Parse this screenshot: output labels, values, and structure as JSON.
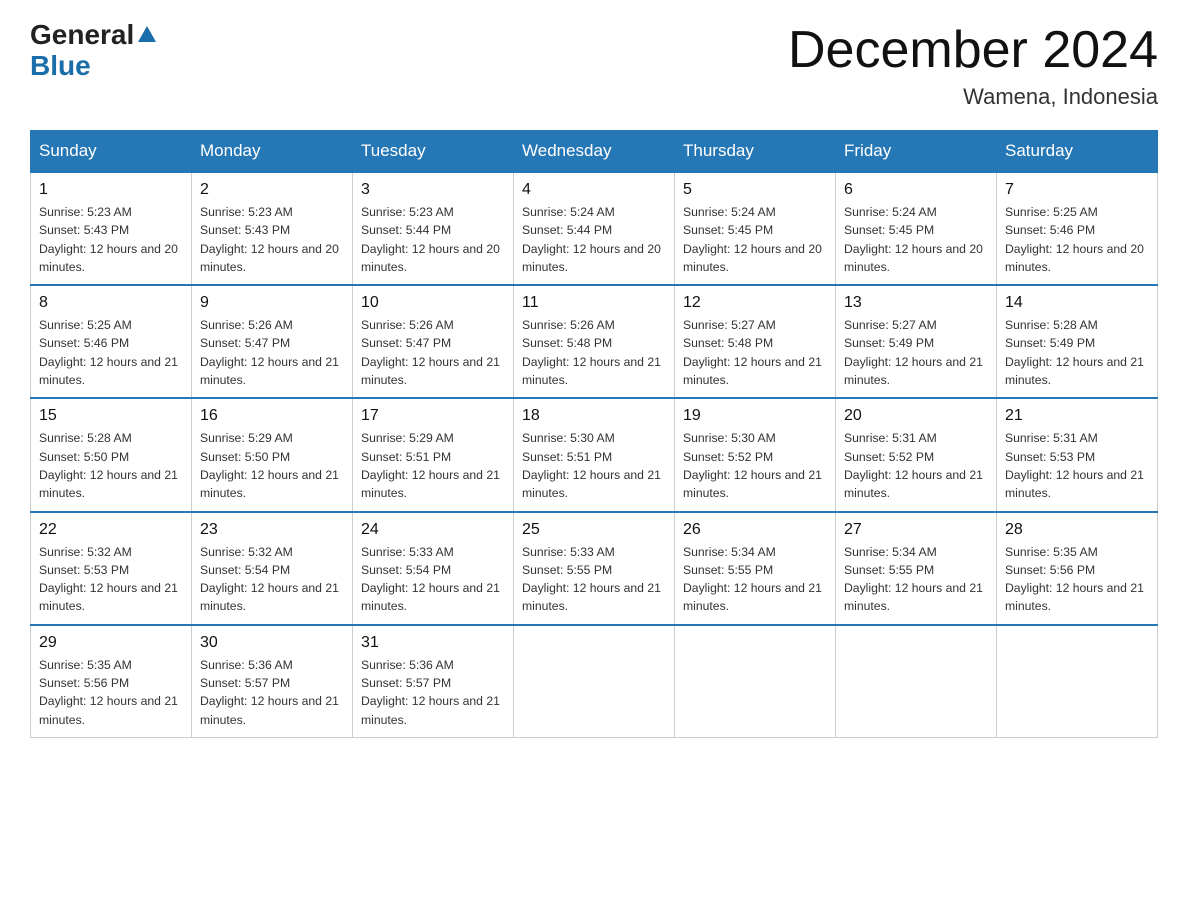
{
  "header": {
    "logo_general": "General",
    "logo_blue": "Blue",
    "title": "December 2024",
    "location": "Wamena, Indonesia"
  },
  "days_of_week": [
    "Sunday",
    "Monday",
    "Tuesday",
    "Wednesday",
    "Thursday",
    "Friday",
    "Saturday"
  ],
  "weeks": [
    [
      {
        "day": "1",
        "sunrise": "5:23 AM",
        "sunset": "5:43 PM",
        "daylight": "12 hours and 20 minutes."
      },
      {
        "day": "2",
        "sunrise": "5:23 AM",
        "sunset": "5:43 PM",
        "daylight": "12 hours and 20 minutes."
      },
      {
        "day": "3",
        "sunrise": "5:23 AM",
        "sunset": "5:44 PM",
        "daylight": "12 hours and 20 minutes."
      },
      {
        "day": "4",
        "sunrise": "5:24 AM",
        "sunset": "5:44 PM",
        "daylight": "12 hours and 20 minutes."
      },
      {
        "day": "5",
        "sunrise": "5:24 AM",
        "sunset": "5:45 PM",
        "daylight": "12 hours and 20 minutes."
      },
      {
        "day": "6",
        "sunrise": "5:24 AM",
        "sunset": "5:45 PM",
        "daylight": "12 hours and 20 minutes."
      },
      {
        "day": "7",
        "sunrise": "5:25 AM",
        "sunset": "5:46 PM",
        "daylight": "12 hours and 20 minutes."
      }
    ],
    [
      {
        "day": "8",
        "sunrise": "5:25 AM",
        "sunset": "5:46 PM",
        "daylight": "12 hours and 21 minutes."
      },
      {
        "day": "9",
        "sunrise": "5:26 AM",
        "sunset": "5:47 PM",
        "daylight": "12 hours and 21 minutes."
      },
      {
        "day": "10",
        "sunrise": "5:26 AM",
        "sunset": "5:47 PM",
        "daylight": "12 hours and 21 minutes."
      },
      {
        "day": "11",
        "sunrise": "5:26 AM",
        "sunset": "5:48 PM",
        "daylight": "12 hours and 21 minutes."
      },
      {
        "day": "12",
        "sunrise": "5:27 AM",
        "sunset": "5:48 PM",
        "daylight": "12 hours and 21 minutes."
      },
      {
        "day": "13",
        "sunrise": "5:27 AM",
        "sunset": "5:49 PM",
        "daylight": "12 hours and 21 minutes."
      },
      {
        "day": "14",
        "sunrise": "5:28 AM",
        "sunset": "5:49 PM",
        "daylight": "12 hours and 21 minutes."
      }
    ],
    [
      {
        "day": "15",
        "sunrise": "5:28 AM",
        "sunset": "5:50 PM",
        "daylight": "12 hours and 21 minutes."
      },
      {
        "day": "16",
        "sunrise": "5:29 AM",
        "sunset": "5:50 PM",
        "daylight": "12 hours and 21 minutes."
      },
      {
        "day": "17",
        "sunrise": "5:29 AM",
        "sunset": "5:51 PM",
        "daylight": "12 hours and 21 minutes."
      },
      {
        "day": "18",
        "sunrise": "5:30 AM",
        "sunset": "5:51 PM",
        "daylight": "12 hours and 21 minutes."
      },
      {
        "day": "19",
        "sunrise": "5:30 AM",
        "sunset": "5:52 PM",
        "daylight": "12 hours and 21 minutes."
      },
      {
        "day": "20",
        "sunrise": "5:31 AM",
        "sunset": "5:52 PM",
        "daylight": "12 hours and 21 minutes."
      },
      {
        "day": "21",
        "sunrise": "5:31 AM",
        "sunset": "5:53 PM",
        "daylight": "12 hours and 21 minutes."
      }
    ],
    [
      {
        "day": "22",
        "sunrise": "5:32 AM",
        "sunset": "5:53 PM",
        "daylight": "12 hours and 21 minutes."
      },
      {
        "day": "23",
        "sunrise": "5:32 AM",
        "sunset": "5:54 PM",
        "daylight": "12 hours and 21 minutes."
      },
      {
        "day": "24",
        "sunrise": "5:33 AM",
        "sunset": "5:54 PM",
        "daylight": "12 hours and 21 minutes."
      },
      {
        "day": "25",
        "sunrise": "5:33 AM",
        "sunset": "5:55 PM",
        "daylight": "12 hours and 21 minutes."
      },
      {
        "day": "26",
        "sunrise": "5:34 AM",
        "sunset": "5:55 PM",
        "daylight": "12 hours and 21 minutes."
      },
      {
        "day": "27",
        "sunrise": "5:34 AM",
        "sunset": "5:55 PM",
        "daylight": "12 hours and 21 minutes."
      },
      {
        "day": "28",
        "sunrise": "5:35 AM",
        "sunset": "5:56 PM",
        "daylight": "12 hours and 21 minutes."
      }
    ],
    [
      {
        "day": "29",
        "sunrise": "5:35 AM",
        "sunset": "5:56 PM",
        "daylight": "12 hours and 21 minutes."
      },
      {
        "day": "30",
        "sunrise": "5:36 AM",
        "sunset": "5:57 PM",
        "daylight": "12 hours and 21 minutes."
      },
      {
        "day": "31",
        "sunrise": "5:36 AM",
        "sunset": "5:57 PM",
        "daylight": "12 hours and 21 minutes."
      },
      {
        "day": "",
        "sunrise": "",
        "sunset": "",
        "daylight": ""
      },
      {
        "day": "",
        "sunrise": "",
        "sunset": "",
        "daylight": ""
      },
      {
        "day": "",
        "sunrise": "",
        "sunset": "",
        "daylight": ""
      },
      {
        "day": "",
        "sunrise": "",
        "sunset": "",
        "daylight": ""
      }
    ]
  ],
  "labels": {
    "sunrise_prefix": "Sunrise: ",
    "sunset_prefix": "Sunset: ",
    "daylight_prefix": "Daylight: "
  }
}
